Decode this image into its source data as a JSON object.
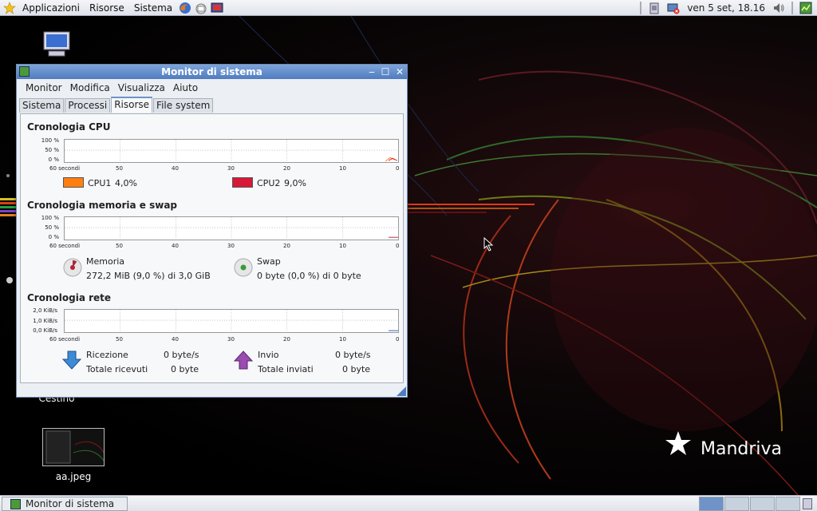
{
  "top_panel": {
    "menus": [
      "Applicazioni",
      "Risorse",
      "Sistema"
    ],
    "clock": "ven  5 set, 18.16"
  },
  "desktop": {
    "icons": [
      {
        "label": "",
        "icon": "computer-icon"
      },
      {
        "label": "Cestino",
        "icon": "trash-icon"
      },
      {
        "label": "aa.jpeg",
        "icon": "image-file-icon"
      }
    ],
    "logo_text": "Mandriva"
  },
  "window": {
    "title": "Monitor di sistema",
    "menu": [
      "Monitor",
      "Modifica",
      "Visualizza",
      "Aiuto"
    ],
    "tabs": [
      "Sistema",
      "Processi",
      "Risorse",
      "File system"
    ],
    "active_tab": "Risorse",
    "cpu": {
      "title": "Cronologia CPU",
      "y_ticks": [
        "100 %",
        "50 %",
        "0 %"
      ],
      "x_ticks": [
        "60 secondi",
        "50",
        "40",
        "30",
        "20",
        "10",
        "0"
      ],
      "legend": [
        {
          "label": "CPU1",
          "value": "4,0%",
          "color": "#ff7f10"
        },
        {
          "label": "CPU2",
          "value": "9,0%",
          "color": "#d81838"
        }
      ]
    },
    "memory": {
      "title": "Cronologia memoria e swap",
      "y_ticks": [
        "100 %",
        "50 %",
        "0 %"
      ],
      "x_ticks": [
        "60 secondi",
        "50",
        "40",
        "30",
        "20",
        "10",
        "0"
      ],
      "mem_label": "Memoria",
      "mem_value": "272,2 MiB (9,0 %) di 3,0 GiB",
      "swap_label": "Swap",
      "swap_value": "0 byte (0,0 %) di 0 byte"
    },
    "network": {
      "title": "Cronologia rete",
      "y_ticks": [
        "2,0 KiB/s",
        "1,0 KiB/s",
        "0,0 KiB/s"
      ],
      "x_ticks": [
        "60 secondi",
        "50",
        "40",
        "30",
        "20",
        "10",
        "0"
      ],
      "recv_label": "Ricezione",
      "recv_value": "0 byte/s",
      "recv_total_label": "Totale ricevuti",
      "recv_total_value": "0 byte",
      "send_label": "Invio",
      "send_value": "0 byte/s",
      "send_total_label": "Totale inviati",
      "send_total_value": "0 byte"
    }
  },
  "taskbar": {
    "task_label": "Monitor di sistema"
  },
  "colors": {
    "accent": "#4f7cc0",
    "cpu1": "#ff7f10",
    "cpu2": "#d81838"
  }
}
